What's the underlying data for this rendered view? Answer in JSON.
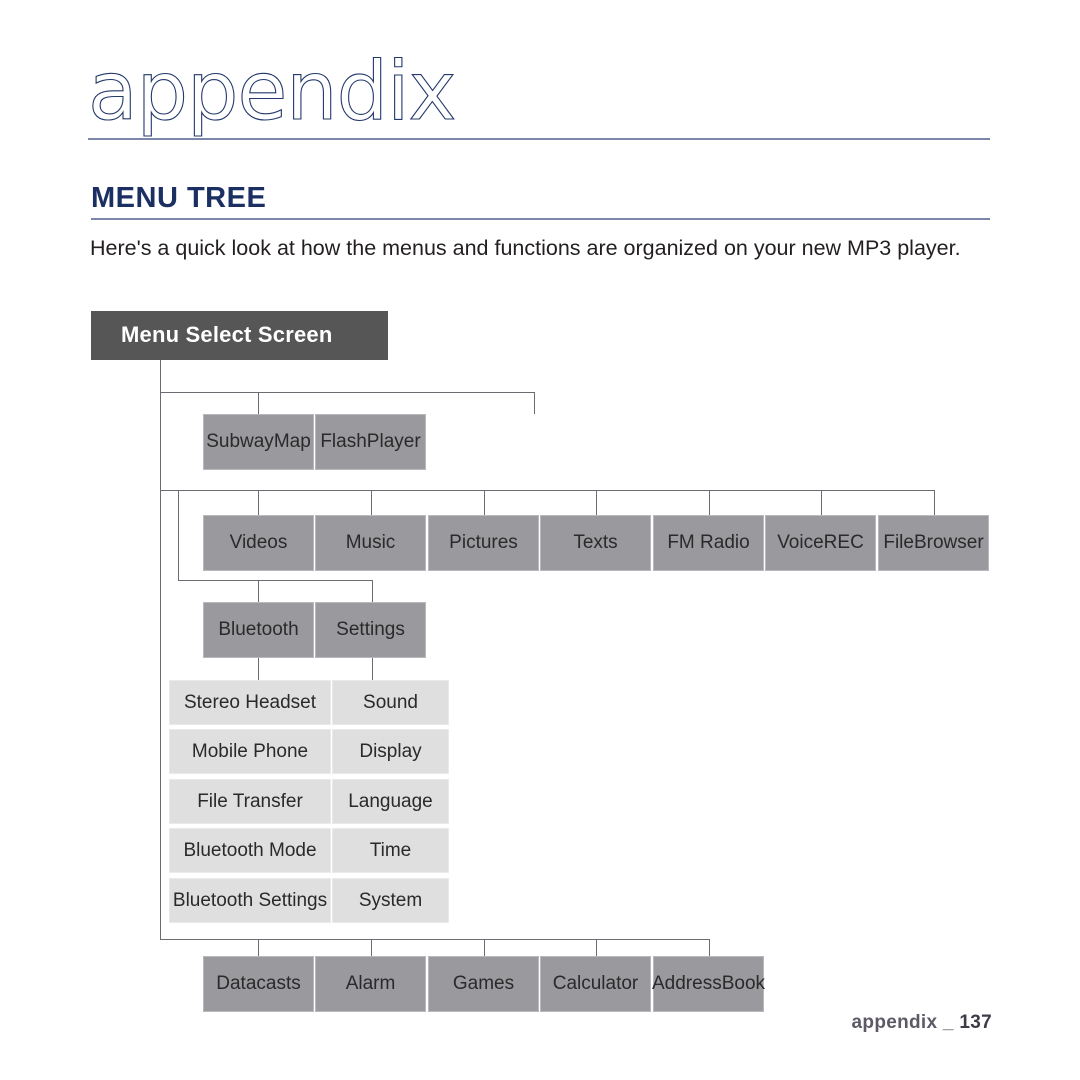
{
  "page": {
    "title": "appendix",
    "section_heading": "MENU TREE",
    "intro": "Here's a quick look at how the menus and functions are organized on your new MP3 player.",
    "footer_label": "appendix _",
    "footer_page": "137"
  },
  "colors": {
    "navy": "#1b2f63",
    "rule": "#7b86a8",
    "root_box": "#565656",
    "dark_box": "#9a9a9e",
    "light_box": "#dfdfdf",
    "line": "#6d6a72",
    "text": "#231f20"
  },
  "tree": {
    "root": "Menu Select Screen",
    "row_flash": [
      {
        "label": "Subway\nMap",
        "line1": "Subway",
        "line2": "Map"
      },
      {
        "label": "Flash\nPlayer",
        "line1": "Flash",
        "line2": "Player"
      }
    ],
    "row_main": [
      {
        "line1": "Videos",
        "line2": ""
      },
      {
        "line1": "Music",
        "line2": ""
      },
      {
        "line1": "Pictures",
        "line2": ""
      },
      {
        "line1": "Texts",
        "line2": ""
      },
      {
        "line1": "FM Radio",
        "line2": ""
      },
      {
        "line1": "Voice",
        "line2": "REC"
      },
      {
        "line1": "File",
        "line2": "Browser"
      }
    ],
    "row_settings_parents": [
      {
        "line1": "Bluetooth",
        "line2": ""
      },
      {
        "line1": "Settings",
        "line2": ""
      }
    ],
    "bluetooth_children": [
      "Stereo Headset",
      "Mobile Phone",
      "File Transfer",
      "Bluetooth Mode",
      "Bluetooth Settings"
    ],
    "settings_children": [
      "Sound",
      "Display",
      "Language",
      "Time",
      "System"
    ],
    "row_bottom": [
      {
        "line1": "Datacasts",
        "line2": ""
      },
      {
        "line1": "Alarm",
        "line2": ""
      },
      {
        "line1": "Games",
        "line2": ""
      },
      {
        "line1": "Calculator",
        "line2": ""
      },
      {
        "line1": "Address",
        "line2": "Book"
      }
    ]
  }
}
